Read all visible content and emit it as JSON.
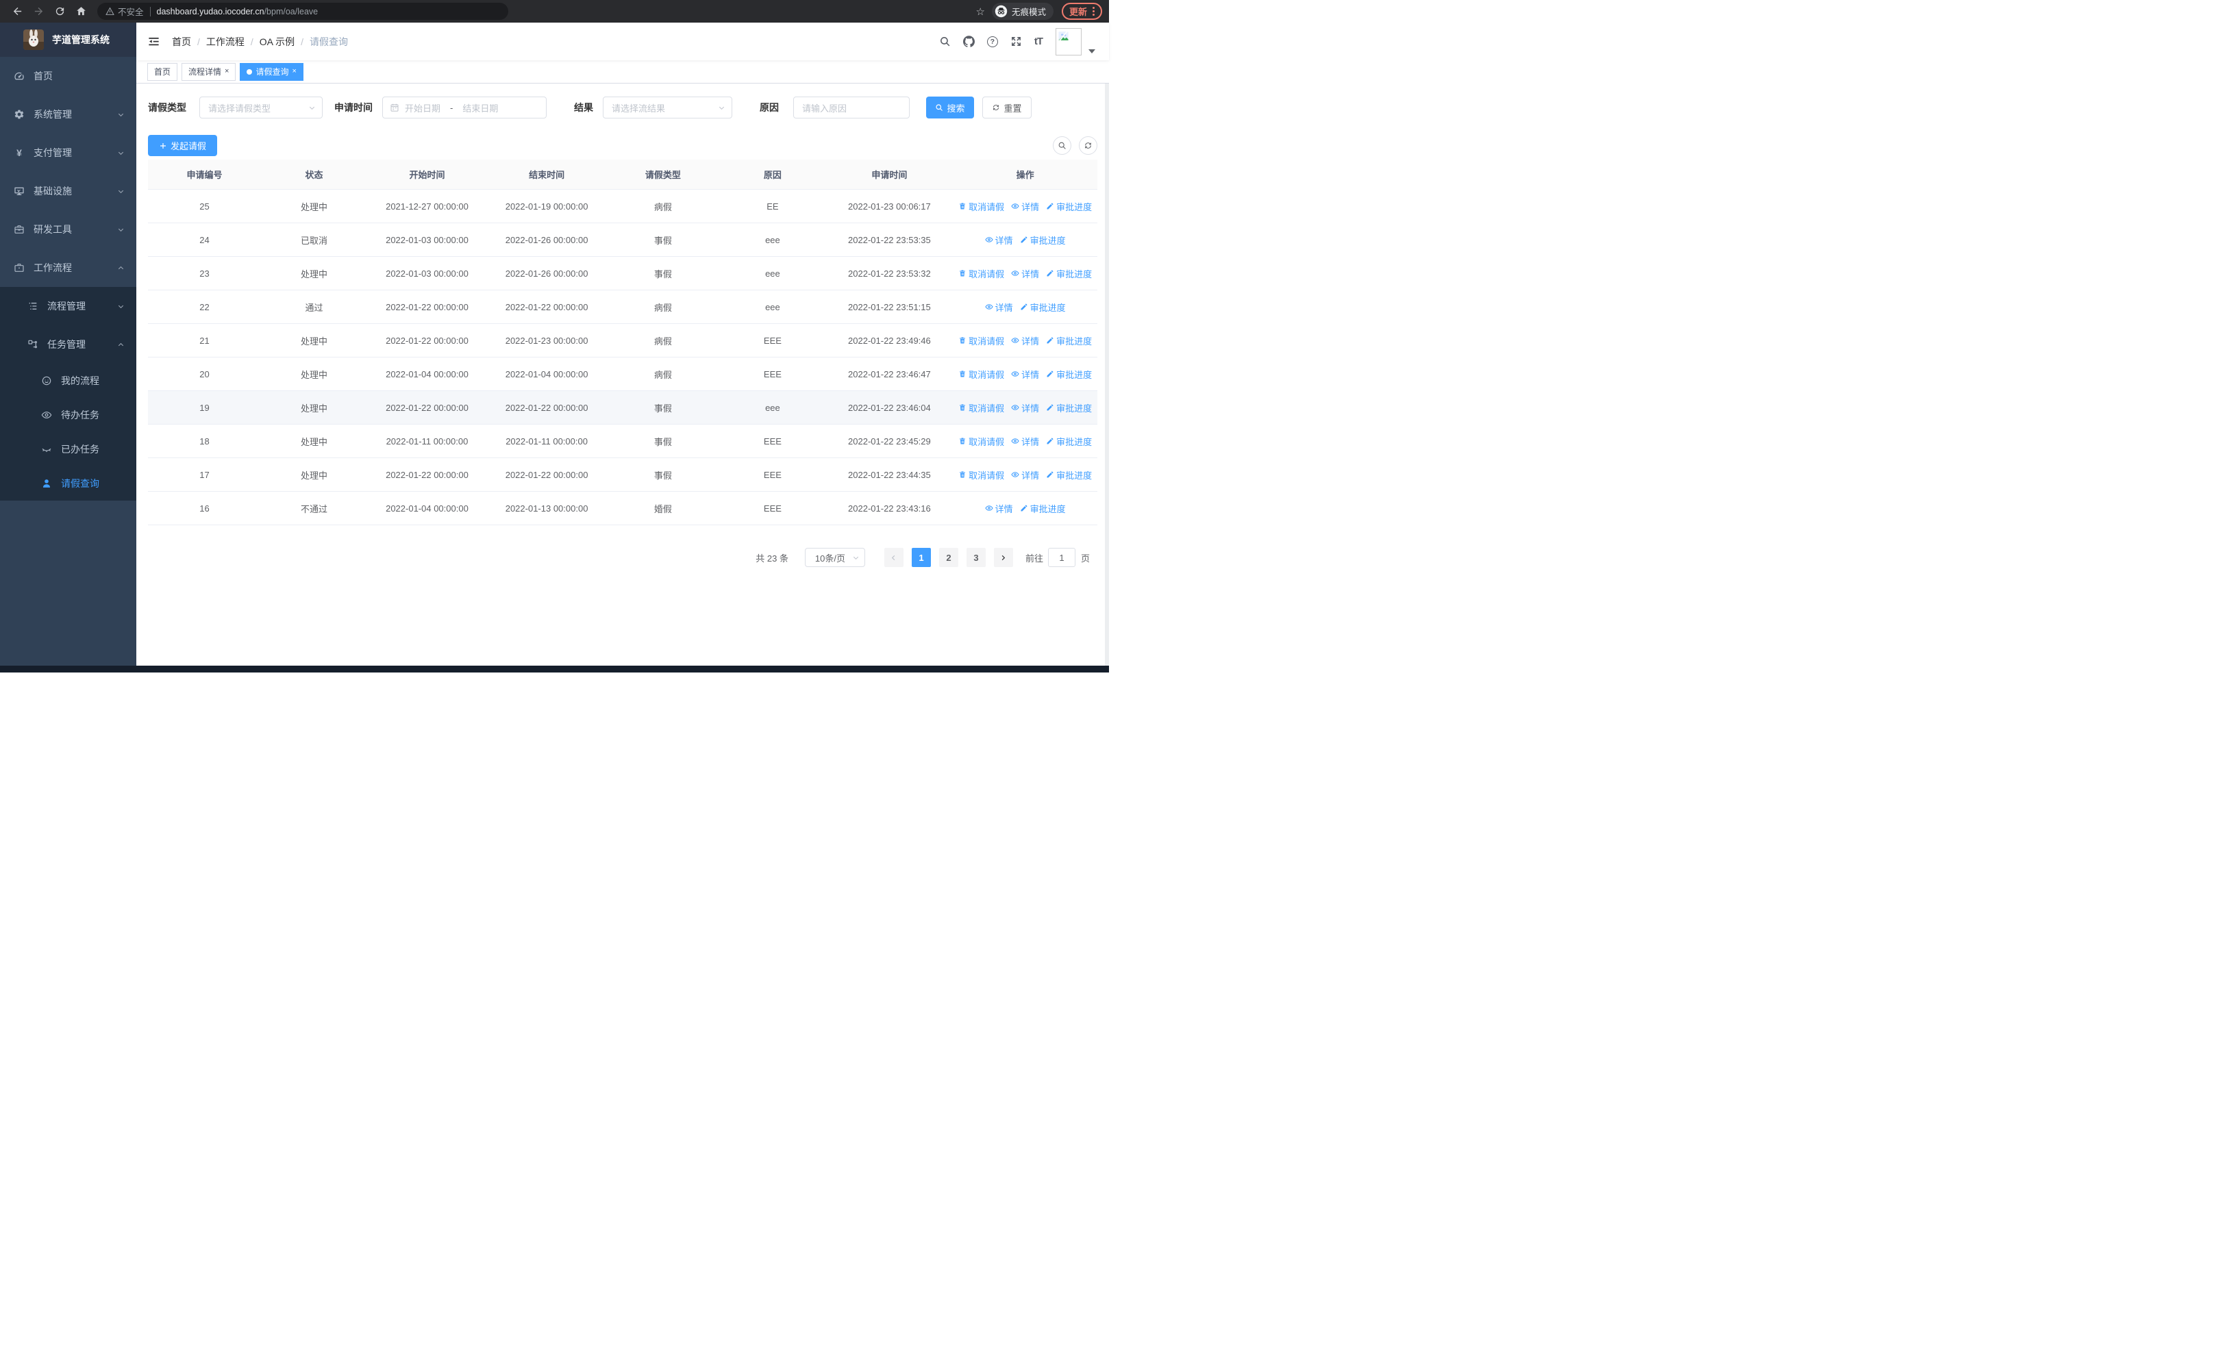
{
  "browser": {
    "security_label": "不安全",
    "url_host": "dashboard.yudao.iocoder.cn",
    "url_path": "/bpm/oa/leave",
    "incognito_label": "无痕模式",
    "update_label": "更新"
  },
  "sidebar": {
    "title": "芋道管理系统",
    "items": [
      {
        "label": "首页"
      },
      {
        "label": "系统管理"
      },
      {
        "label": "支付管理"
      },
      {
        "label": "基础设施"
      },
      {
        "label": "研发工具"
      },
      {
        "label": "工作流程"
      }
    ],
    "sub_items": [
      {
        "label": "流程管理"
      },
      {
        "label": "任务管理"
      }
    ],
    "leaf_items": [
      {
        "label": "我的流程"
      },
      {
        "label": "待办任务"
      },
      {
        "label": "已办任务"
      },
      {
        "label": "请假查询"
      }
    ]
  },
  "breadcrumb": {
    "items": [
      "首页",
      "工作流程",
      "OA 示例",
      "请假查询"
    ]
  },
  "tabs": [
    {
      "label": "首页"
    },
    {
      "label": "流程详情"
    },
    {
      "label": "请假查询"
    }
  ],
  "filters": {
    "type_label": "请假类型",
    "type_placeholder": "请选择请假类型",
    "time_label": "申请时间",
    "start_placeholder": "开始日期",
    "range_separator": "-",
    "end_placeholder": "结束日期",
    "result_label": "结果",
    "result_placeholder": "请选择流结果",
    "reason_label": "原因",
    "reason_placeholder": "请输入原因",
    "search_label": "搜索",
    "reset_label": "重置"
  },
  "toolbar": {
    "create_label": "发起请假"
  },
  "table": {
    "columns": [
      "申请编号",
      "状态",
      "开始时间",
      "结束时间",
      "请假类型",
      "原因",
      "申请时间",
      "操作"
    ],
    "action_labels": {
      "cancel": "取消请假",
      "detail": "详情",
      "progress": "审批进度"
    },
    "rows": [
      {
        "id": "25",
        "status": "处理中",
        "start": "2021-12-27 00:00:00",
        "end": "2022-01-19 00:00:00",
        "type": "病假",
        "reason": "EE",
        "applied": "2022-01-23 00:06:17",
        "actions": [
          "cancel",
          "detail",
          "progress"
        ],
        "highlight": false
      },
      {
        "id": "24",
        "status": "已取消",
        "start": "2022-01-03 00:00:00",
        "end": "2022-01-26 00:00:00",
        "type": "事假",
        "reason": "eee",
        "applied": "2022-01-22 23:53:35",
        "actions": [
          "detail",
          "progress"
        ],
        "highlight": false
      },
      {
        "id": "23",
        "status": "处理中",
        "start": "2022-01-03 00:00:00",
        "end": "2022-01-26 00:00:00",
        "type": "事假",
        "reason": "eee",
        "applied": "2022-01-22 23:53:32",
        "actions": [
          "cancel",
          "detail",
          "progress"
        ],
        "highlight": false
      },
      {
        "id": "22",
        "status": "通过",
        "start": "2022-01-22 00:00:00",
        "end": "2022-01-22 00:00:00",
        "type": "病假",
        "reason": "eee",
        "applied": "2022-01-22 23:51:15",
        "actions": [
          "detail",
          "progress"
        ],
        "highlight": false
      },
      {
        "id": "21",
        "status": "处理中",
        "start": "2022-01-22 00:00:00",
        "end": "2022-01-23 00:00:00",
        "type": "病假",
        "reason": "EEE",
        "applied": "2022-01-22 23:49:46",
        "actions": [
          "cancel",
          "detail",
          "progress"
        ],
        "highlight": false
      },
      {
        "id": "20",
        "status": "处理中",
        "start": "2022-01-04 00:00:00",
        "end": "2022-01-04 00:00:00",
        "type": "病假",
        "reason": "EEE",
        "applied": "2022-01-22 23:46:47",
        "actions": [
          "cancel",
          "detail",
          "progress"
        ],
        "highlight": false
      },
      {
        "id": "19",
        "status": "处理中",
        "start": "2022-01-22 00:00:00",
        "end": "2022-01-22 00:00:00",
        "type": "事假",
        "reason": "eee",
        "applied": "2022-01-22 23:46:04",
        "actions": [
          "cancel",
          "detail",
          "progress"
        ],
        "highlight": true
      },
      {
        "id": "18",
        "status": "处理中",
        "start": "2022-01-11 00:00:00",
        "end": "2022-01-11 00:00:00",
        "type": "事假",
        "reason": "EEE",
        "applied": "2022-01-22 23:45:29",
        "actions": [
          "cancel",
          "detail",
          "progress"
        ],
        "highlight": false
      },
      {
        "id": "17",
        "status": "处理中",
        "start": "2022-01-22 00:00:00",
        "end": "2022-01-22 00:00:00",
        "type": "事假",
        "reason": "EEE",
        "applied": "2022-01-22 23:44:35",
        "actions": [
          "cancel",
          "detail",
          "progress"
        ],
        "highlight": false
      },
      {
        "id": "16",
        "status": "不通过",
        "start": "2022-01-04 00:00:00",
        "end": "2022-01-13 00:00:00",
        "type": "婚假",
        "reason": "EEE",
        "applied": "2022-01-22 23:43:16",
        "actions": [
          "detail",
          "progress"
        ],
        "highlight": false
      }
    ]
  },
  "pagination": {
    "total": "共 23 条",
    "page_size": "10条/页",
    "pages": [
      "1",
      "2",
      "3"
    ],
    "active_page": "1",
    "goto_label": "前往",
    "goto_value": "1",
    "page_unit": "页"
  },
  "colors": {
    "accent": "#409EFF",
    "sidebar_bg": "#304156",
    "submenu_bg": "#1f2d3d",
    "update_red": "#ee7b6e"
  }
}
